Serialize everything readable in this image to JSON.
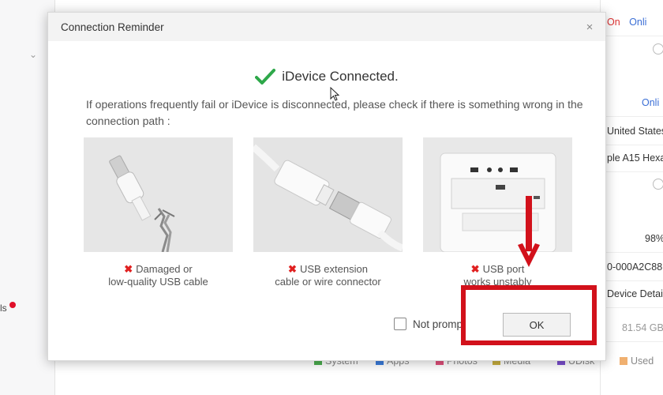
{
  "dialog": {
    "title": "Connection Reminder",
    "close_label": "×",
    "status_text": "iDevice Connected.",
    "message": "If operations frequently fail or iDevice is disconnected, please check if there is something wrong in the connection path :",
    "cards": [
      {
        "icon": "red-x-icon",
        "mark": "✖",
        "caption_line1": "Damaged or",
        "caption_line2": "low-quality USB cable"
      },
      {
        "icon": "red-x-icon",
        "mark": "✖",
        "caption_line1": "USB extension",
        "caption_line2": "cable or wire connector"
      },
      {
        "icon": "red-x-icon",
        "mark": "✖",
        "caption_line1": "USB port",
        "caption_line2": "works unstably"
      }
    ],
    "checkbox_label": "Not promp",
    "ok_label": "OK"
  },
  "background": {
    "right_panel": [
      "On",
      "Onli",
      "Onli",
      "United States",
      "ple A15 Hexa",
      "98%",
      "0-000A2C88",
      "Device Detai",
      "81.54 GB"
    ],
    "left_panel_text": "ls",
    "legend": [
      "System",
      "Apps",
      "Photos",
      "Media",
      "UDisk",
      "Used"
    ]
  },
  "colors": {
    "accent_red": "#d2111b",
    "check_green": "#2ea84a",
    "x_red": "#e02020",
    "legend": [
      "#4caf50",
      "#3b7ddd",
      "#e0507a",
      "#c9b040",
      "#7b4fcf",
      "#f0b070"
    ]
  }
}
